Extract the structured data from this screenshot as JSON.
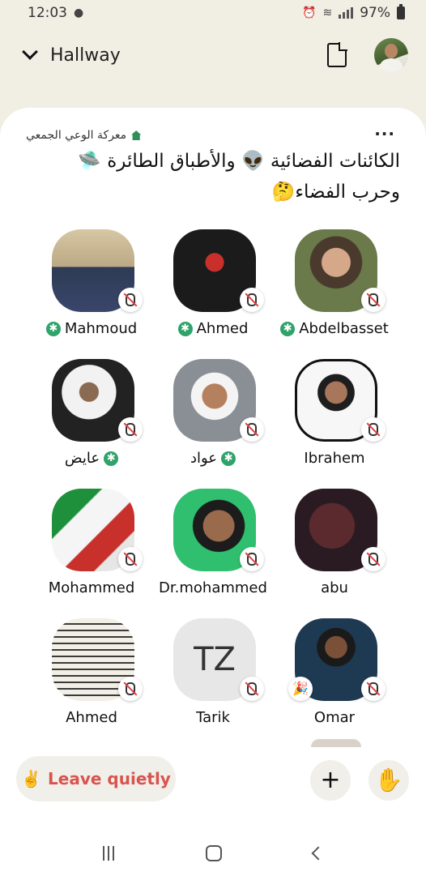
{
  "status_bar": {
    "time": "12:03",
    "battery": "97%"
  },
  "header": {
    "title": "Hallway"
  },
  "room": {
    "club_name": "معركة الوعي الجمعي",
    "title_line1": "الكائنات الفضائية 👽 والأطباق الطائرة 🛸",
    "title_line2": "وحرب الفضاء🤔"
  },
  "speakers": [
    {
      "name": "Mahmoud",
      "moderator": true
    },
    {
      "name": "Ahmed",
      "moderator": true
    },
    {
      "name": "Abdelbasset",
      "moderator": true
    },
    {
      "name": "عايض",
      "moderator": true
    },
    {
      "name": "عواد",
      "moderator": true
    },
    {
      "name": "Ibrahem",
      "moderator": false
    },
    {
      "name": "Mohammed",
      "moderator": false
    },
    {
      "name": "Dr.mohammed",
      "moderator": false
    },
    {
      "name": "abu",
      "moderator": false
    },
    {
      "name": "Ahmed",
      "moderator": false
    },
    {
      "name": "Tarik",
      "moderator": false,
      "initials": "TZ"
    },
    {
      "name": "Omar",
      "moderator": false,
      "badge": "🎉"
    }
  ],
  "bottom_bar": {
    "leave_emoji": "✌️",
    "leave_label": "Leave quietly",
    "add_icon": "+",
    "raise_hand_icon": "✋"
  }
}
